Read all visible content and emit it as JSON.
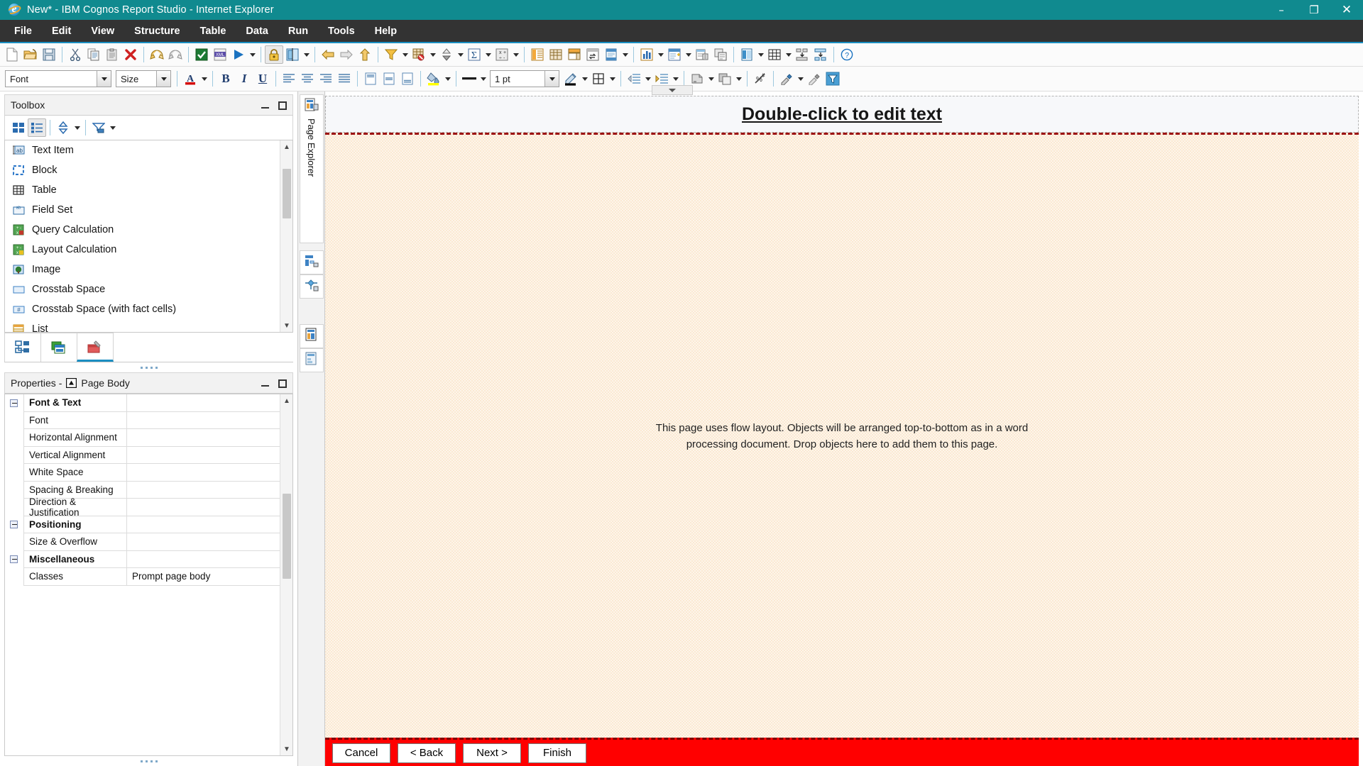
{
  "window": {
    "title": "New* - IBM Cognos Report Studio - Internet Explorer",
    "logo_icon": "internet-explorer-icon",
    "controls": {
      "minimize": "–",
      "maximize": "❐",
      "close": "✕"
    }
  },
  "menubar": {
    "items": [
      "File",
      "Edit",
      "View",
      "Structure",
      "Table",
      "Data",
      "Run",
      "Tools",
      "Help"
    ]
  },
  "toolbar_main": {
    "groups": [
      {
        "buttons": [
          {
            "name": "new-report-icon",
            "label": "New"
          },
          {
            "name": "open-report-icon",
            "label": "Open"
          },
          {
            "name": "save-report-icon",
            "label": "Save"
          }
        ]
      },
      {
        "buttons": [
          {
            "name": "cut-icon",
            "label": "Cut"
          },
          {
            "name": "copy-icon",
            "label": "Copy"
          },
          {
            "name": "paste-icon",
            "label": "Paste"
          },
          {
            "name": "delete-icon",
            "label": "Delete"
          }
        ]
      },
      {
        "buttons": [
          {
            "name": "undo-icon",
            "label": "Undo"
          },
          {
            "name": "redo-icon",
            "label": "Redo"
          }
        ]
      },
      {
        "buttons": [
          {
            "name": "validate-report-icon",
            "label": "Validate Report"
          },
          {
            "name": "view-xml-icon",
            "label": "View XML"
          },
          {
            "name": "run-report-icon",
            "label": "Run Report",
            "has_caret": true
          }
        ]
      },
      {
        "buttons": [
          {
            "name": "lock-icon",
            "label": "Lock/Unlock",
            "pressed": true
          },
          {
            "name": "page-design-icon",
            "label": "Page Design",
            "has_caret": true
          }
        ]
      },
      {
        "buttons": [
          {
            "name": "back-arrow-icon",
            "label": "Back"
          },
          {
            "name": "forward-arrow-icon",
            "label": "Forward"
          },
          {
            "name": "up-arrow-icon",
            "label": "Up"
          }
        ]
      },
      {
        "buttons": [
          {
            "name": "filter-icon",
            "label": "Filters",
            "has_caret": true
          },
          {
            "name": "suppress-icon",
            "label": "Suppress",
            "has_caret": true
          },
          {
            "name": "sort-icon",
            "label": "Sort",
            "has_caret": true
          },
          {
            "name": "summarize-icon",
            "label": "Summarize",
            "has_caret": true
          },
          {
            "name": "calculate-icon",
            "label": "Calculate",
            "has_caret": true
          }
        ]
      },
      {
        "buttons": [
          {
            "name": "section-icon",
            "label": "Section"
          },
          {
            "name": "group-icon",
            "label": "Group"
          },
          {
            "name": "pivot-icon",
            "label": "Pivot"
          },
          {
            "name": "swap-rows-columns-icon",
            "label": "Swap Rows and Columns"
          },
          {
            "name": "headers-footers-icon",
            "label": "Headers & Footers",
            "has_caret": true
          }
        ]
      },
      {
        "buttons": [
          {
            "name": "chart-icon",
            "label": "Chart",
            "has_caret": true
          },
          {
            "name": "insert-list-icon",
            "label": "Insert List",
            "has_caret": true
          },
          {
            "name": "build-prompt-page-icon",
            "label": "Build Prompt Page"
          },
          {
            "name": "repeater-icon",
            "label": "Repeater"
          }
        ]
      },
      {
        "buttons": [
          {
            "name": "page-layers-icon",
            "label": "Page Layers",
            "has_caret": true
          },
          {
            "name": "table-grid-icon",
            "label": "Table",
            "has_caret": true
          },
          {
            "name": "align-middle-icon",
            "label": "Align Middle"
          },
          {
            "name": "align-bottom-icon",
            "label": "Align Bottom"
          }
        ]
      },
      {
        "buttons": [
          {
            "name": "help-icon",
            "label": "Help"
          }
        ]
      }
    ]
  },
  "toolbar_format": {
    "font_combo": {
      "name": "font-select",
      "value": "Font"
    },
    "size_combo": {
      "name": "size-select",
      "value": "Size"
    },
    "font_color": {
      "name": "font-color-icon",
      "label": "Font Color",
      "color": "#d40000"
    },
    "bold": {
      "name": "bold-button",
      "label": "B"
    },
    "italic": {
      "name": "italic-button",
      "label": "I"
    },
    "underline": {
      "name": "underline-button",
      "label": "U"
    },
    "align": [
      {
        "name": "align-left-icon",
        "label": "Align Left"
      },
      {
        "name": "align-center-icon",
        "label": "Align Center"
      },
      {
        "name": "align-right-icon",
        "label": "Align Right"
      },
      {
        "name": "align-justify-icon",
        "label": "Justify"
      }
    ],
    "valign": [
      {
        "name": "valign-top-icon",
        "label": "Align Top"
      },
      {
        "name": "valign-middle-icon",
        "label": "Align Middle"
      },
      {
        "name": "valign-bottom-icon",
        "label": "Align Bottom"
      }
    ],
    "background_color": {
      "name": "background-color-icon",
      "label": "Background Color",
      "color": "#ffff00"
    },
    "border_style": {
      "name": "border-style-icon",
      "label": "Border Style"
    },
    "border_width": {
      "name": "border-width-select",
      "value": "1 pt"
    },
    "border_color": {
      "name": "border-color-icon",
      "label": "Border Color",
      "color": "#000000"
    },
    "borders": {
      "name": "borders-icon",
      "label": "Borders"
    },
    "indent_decrease": {
      "name": "decrease-indent-icon",
      "label": "Decrease Indent"
    },
    "indent_increase": {
      "name": "increase-indent-icon",
      "label": "Increase Indent"
    },
    "padding": {
      "name": "padding-icon",
      "label": "Padding"
    },
    "margin": {
      "name": "margin-icon",
      "label": "Margin"
    },
    "clear_styles": {
      "name": "clear-styles-icon",
      "label": "Clear Styles"
    },
    "pick_style": {
      "name": "pick-up-style-icon",
      "label": "Pick Up Style"
    },
    "apply_style": {
      "name": "apply-style-icon",
      "label": "Apply Style"
    },
    "conditional_style": {
      "name": "conditional-style-icon",
      "label": "Conditional Styles"
    }
  },
  "toolbox": {
    "title": "Toolbox",
    "view_toggle": [
      {
        "name": "icon-view-button",
        "label": "Icon View"
      },
      {
        "name": "list-view-button",
        "label": "List View",
        "active": true
      }
    ],
    "sort_button": {
      "name": "sort-toolbox-icon",
      "label": "Sort"
    },
    "filter_button": {
      "name": "filter-toolbox-icon",
      "label": "Filter"
    },
    "items": [
      {
        "label": "Text Item",
        "icon": "text-item-icon"
      },
      {
        "label": "Block",
        "icon": "block-icon"
      },
      {
        "label": "Table",
        "icon": "table-icon"
      },
      {
        "label": "Field Set",
        "icon": "field-set-icon"
      },
      {
        "label": "Query Calculation",
        "icon": "query-calculation-icon"
      },
      {
        "label": "Layout Calculation",
        "icon": "layout-calculation-icon"
      },
      {
        "label": "Image",
        "icon": "image-icon"
      },
      {
        "label": "Crosstab Space",
        "icon": "crosstab-space-icon"
      },
      {
        "label": "Crosstab Space (with fact cells)",
        "icon": "crosstab-space-fact-icon"
      },
      {
        "label": "List",
        "icon": "list-icon"
      }
    ],
    "tabs": [
      {
        "name": "tab-insertable-objects-source",
        "icon": "source-tree-icon"
      },
      {
        "name": "tab-insertable-objects-data",
        "icon": "data-items-icon"
      },
      {
        "name": "tab-insertable-objects-toolbox",
        "icon": "toolbox-tab-icon",
        "active": true
      }
    ]
  },
  "properties": {
    "title_prefix": "Properties - ",
    "target_icon": "page-body-icon",
    "target": "Page Body",
    "rows": [
      {
        "name": "Font & Text",
        "value": "",
        "group": true
      },
      {
        "name": "Font",
        "value": ""
      },
      {
        "name": "Horizontal Alignment",
        "value": ""
      },
      {
        "name": "Vertical Alignment",
        "value": ""
      },
      {
        "name": "White Space",
        "value": ""
      },
      {
        "name": "Spacing & Breaking",
        "value": ""
      },
      {
        "name": "Direction & Justification",
        "value": ""
      },
      {
        "name": "Positioning",
        "value": "",
        "group": true
      },
      {
        "name": "Size & Overflow",
        "value": ""
      },
      {
        "name": "Miscellaneous",
        "value": "",
        "group": true
      },
      {
        "name": "Classes",
        "value": "Prompt page body"
      }
    ]
  },
  "page_explorer": {
    "label": "Page Explorer",
    "icon": "page-explorer-icon",
    "tabs": [
      {
        "name": "tab-page-explorer",
        "icon": "page-explorer-icon"
      },
      {
        "name": "tab-query-explorer",
        "icon": "query-explorer-icon"
      },
      {
        "name": "tab-condition-explorer",
        "icon": "condition-explorer-icon"
      },
      {
        "name": "tab-report-pages",
        "icon": "report-pages-icon"
      },
      {
        "name": "tab-prompt-pages",
        "icon": "prompt-pages-icon"
      }
    ]
  },
  "canvas": {
    "header_text": "Double-click to edit text",
    "flow_message": "This page uses flow layout.  Objects will be arranged top-to-bottom as in a word processing document.  Drop objects here to add them to this page.",
    "body_background": "#fbe9d2",
    "body_border_color": "#9c1212"
  },
  "wizard": {
    "background": "#ff0000",
    "buttons": [
      {
        "name": "cancel-button",
        "label": "Cancel"
      },
      {
        "name": "back-button",
        "label": "< Back"
      },
      {
        "name": "next-button",
        "label": "Next >"
      },
      {
        "name": "finish-button",
        "label": "Finish"
      }
    ]
  }
}
